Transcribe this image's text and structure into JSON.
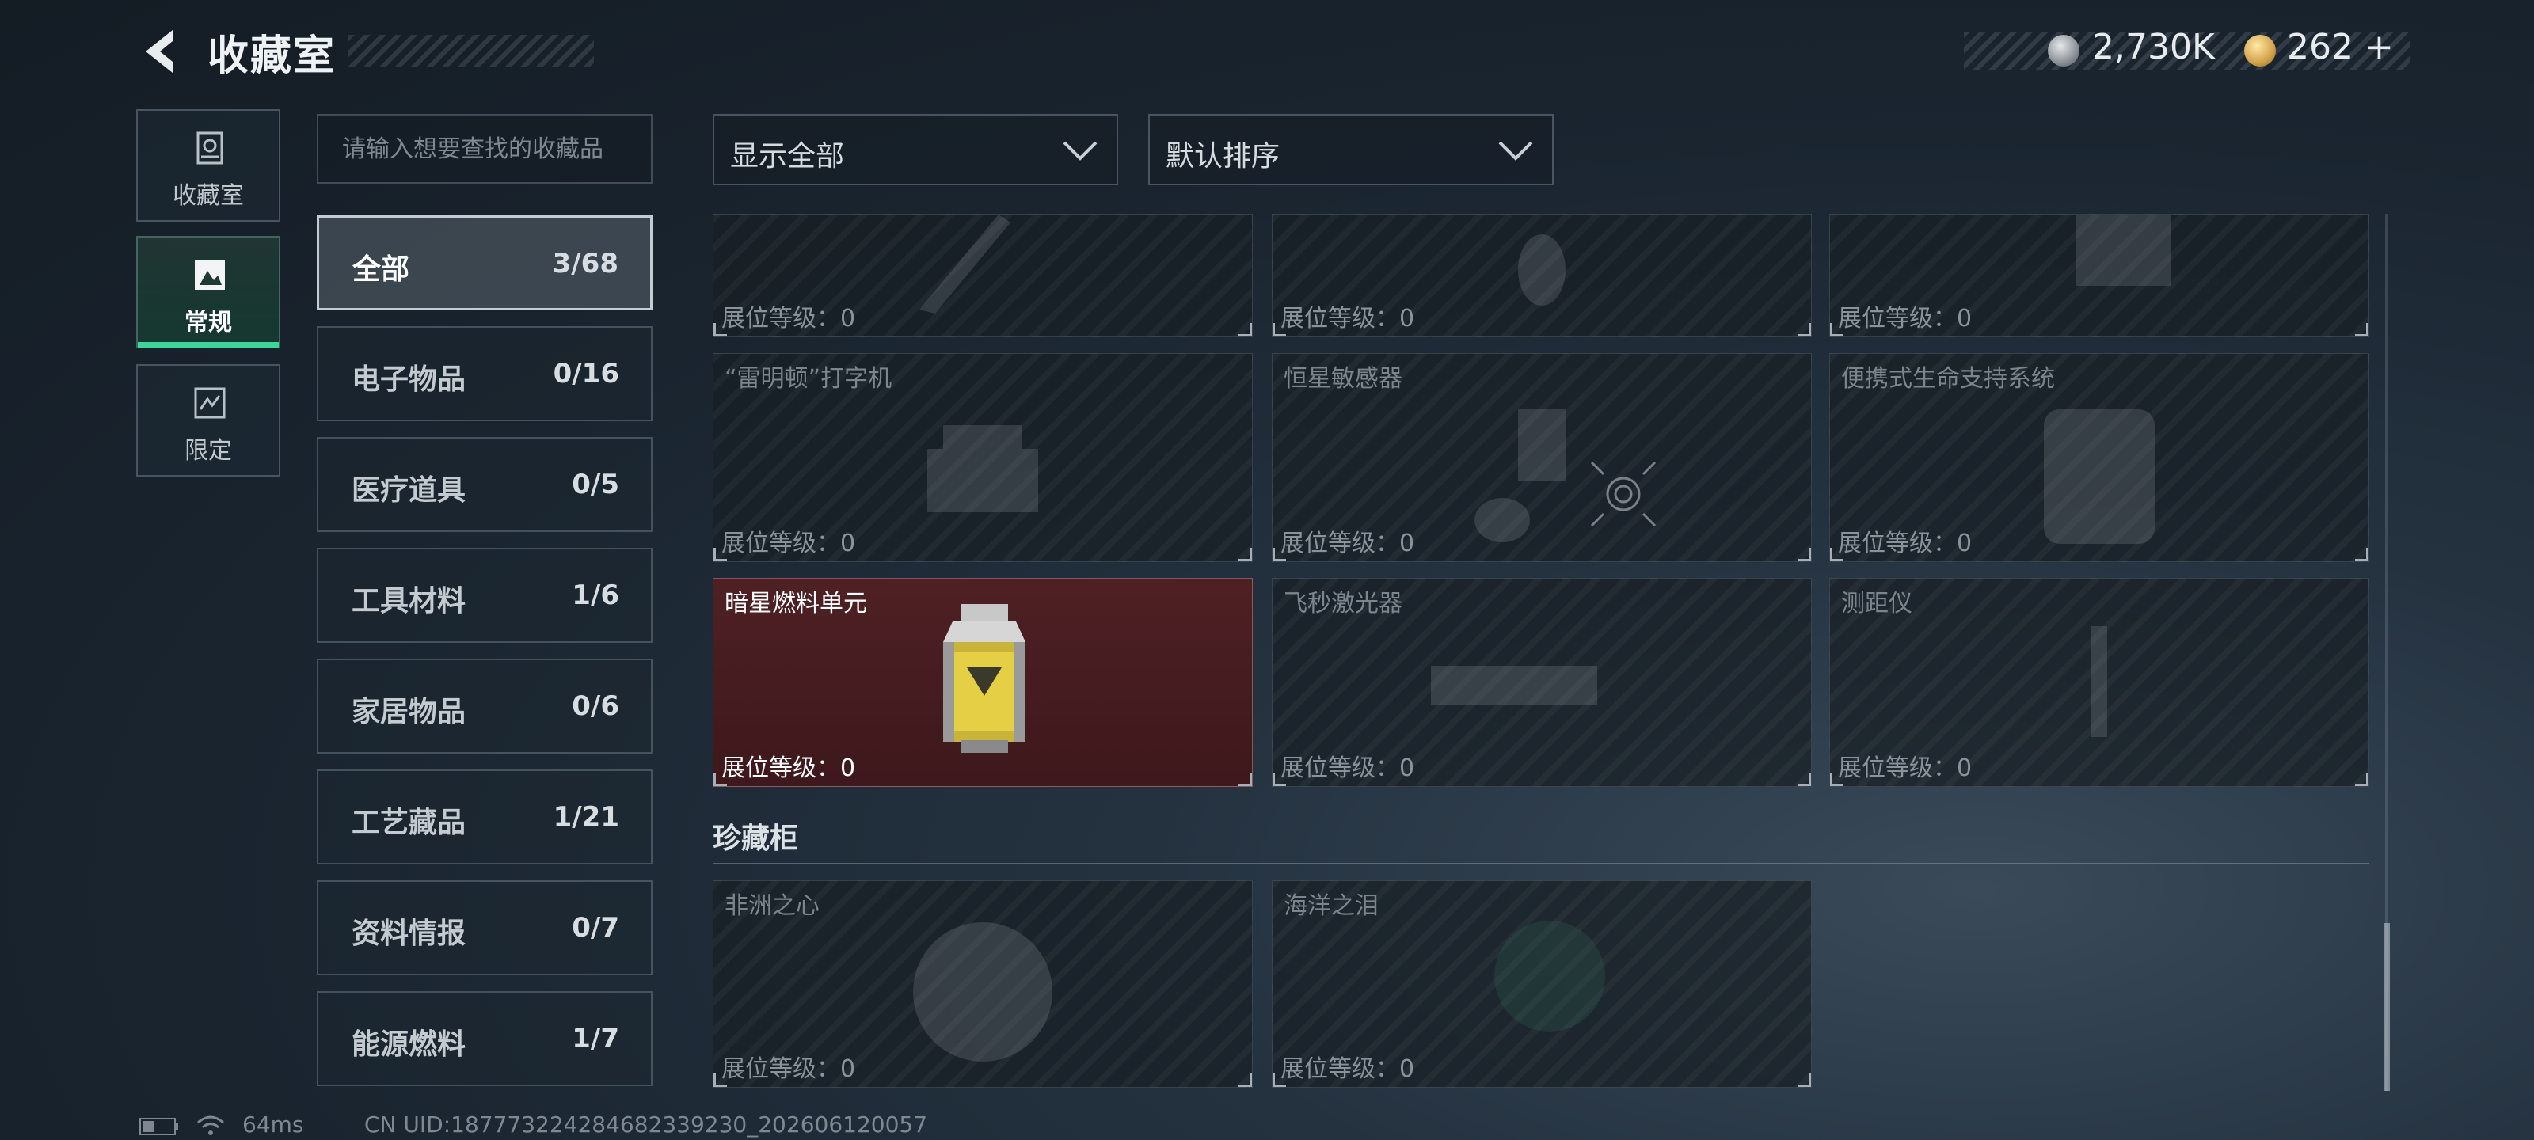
{
  "header": {
    "title": "收藏室",
    "currency1_value": "2,730K",
    "currency2_value": "262",
    "add_symbol": "+"
  },
  "nav": {
    "tabs": [
      {
        "label": "收藏室",
        "icon": "collection-room-icon"
      },
      {
        "label": "常规",
        "icon": "regular-icon",
        "active": true
      },
      {
        "label": "限定",
        "icon": "limited-icon"
      }
    ]
  },
  "search": {
    "placeholder": "请输入想要查找的收藏品"
  },
  "categories": [
    {
      "name": "全部",
      "count": "3/68",
      "active": true
    },
    {
      "name": "电子物品",
      "count": "0/16"
    },
    {
      "name": "医疗道具",
      "count": "0/5"
    },
    {
      "name": "工具材料",
      "count": "1/6"
    },
    {
      "name": "家居物品",
      "count": "0/6"
    },
    {
      "name": "工艺藏品",
      "count": "1/21"
    },
    {
      "name": "资料情报",
      "count": "0/7"
    },
    {
      "name": "能源燃料",
      "count": "1/7"
    }
  ],
  "filters": {
    "display": "显示全部",
    "sort": "默认排序"
  },
  "items": [
    {
      "name": "",
      "level_text": "展位等级：0"
    },
    {
      "name": "",
      "level_text": "展位等级：0"
    },
    {
      "name": "",
      "level_text": "展位等级：0"
    },
    {
      "name": "“雷明顿”打字机",
      "level_text": "展位等级：0"
    },
    {
      "name": "恒星敏感器",
      "level_text": "展位等级：0"
    },
    {
      "name": "便携式生命支持系统",
      "level_text": "展位等级：0"
    },
    {
      "name": "暗星燃料单元",
      "level_text": "展位等级：0",
      "owned": true
    },
    {
      "name": "飞秒激光器",
      "level_text": "展位等级：0"
    },
    {
      "name": "测距仪",
      "level_text": "展位等级：0"
    }
  ],
  "treasure_section": {
    "title": "珍藏柜",
    "items": [
      {
        "name": "非洲之心",
        "level_text": "展位等级：0"
      },
      {
        "name": "海洋之泪",
        "level_text": "展位等级：0"
      }
    ]
  },
  "footer": {
    "ping": "64ms",
    "uid": "CN UID:187773224284682339230_202606120057"
  },
  "colors": {
    "accent": "#3ed698",
    "owned_card": "#4e2024"
  }
}
